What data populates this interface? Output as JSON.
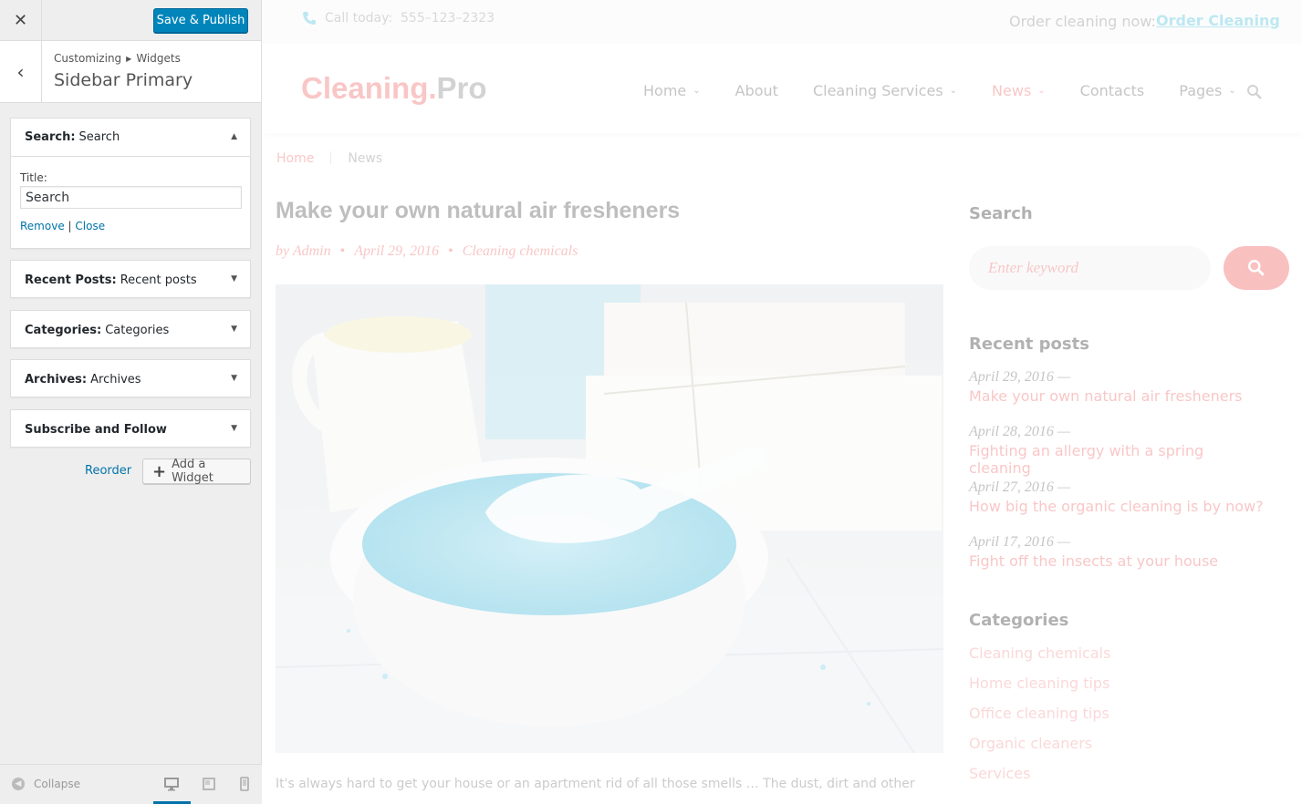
{
  "customizer": {
    "save_label": "Save & Publish",
    "breadcrumb_parent": "Customizing",
    "breadcrumb_child": "Widgets",
    "section_title": "Sidebar Primary",
    "widgets": {
      "search": {
        "type": "Search:",
        "name": "Search",
        "title_label": "Title:",
        "title_value": "Search",
        "remove": "Remove",
        "sep": "|",
        "close": "Close"
      },
      "recent": {
        "type": "Recent Posts:",
        "name": "Recent posts"
      },
      "categories": {
        "type": "Categories:",
        "name": "Categories"
      },
      "archives": {
        "type": "Archives:",
        "name": "Archives"
      },
      "subscribe": {
        "type": "Subscribe and Follow",
        "name": ""
      }
    },
    "reorder": "Reorder",
    "add_widget": "Add a Widget",
    "collapse": "Collapse"
  },
  "site": {
    "call_label": "Call today:",
    "phone": "555–123–2323",
    "order_label": "Order cleaning now:",
    "order_link": "Order Cleaning",
    "logo_a": "Cleaning.",
    "logo_b": "Pro",
    "nav": [
      {
        "label": "Home",
        "dropdown": true
      },
      {
        "label": "About",
        "dropdown": false
      },
      {
        "label": "Cleaning Services",
        "dropdown": true
      },
      {
        "label": "News",
        "dropdown": true,
        "active": true
      },
      {
        "label": "Contacts",
        "dropdown": false
      },
      {
        "label": "Pages",
        "dropdown": true
      }
    ],
    "crumb_home": "Home",
    "crumb_current": "News",
    "post_title": "Make your own natural air fresheners",
    "meta_author": "by Admin",
    "meta_date": "April 29, 2016",
    "meta_category": "Cleaning chemicals",
    "excerpt": "It's always hard to get your house or an apartment rid of all those smells … The dust, dirt and other",
    "sidebar": {
      "search_heading": "Search",
      "search_placeholder": "Enter keyword",
      "recent_heading": "Recent posts",
      "recent": [
        {
          "date": "April 29, 2016 —",
          "title": "Make your own natural air fresheners"
        },
        {
          "date": "April 28, 2016 —",
          "title": "Fighting an allergy with a spring cleaning"
        },
        {
          "date": "April 27, 2016 —",
          "title": "How big the organic cleaning is by now?"
        },
        {
          "date": "April 17, 2016 —",
          "title": "Fight off the insects at your house"
        }
      ],
      "categories_heading": "Categories",
      "categories": [
        "Cleaning chemicals",
        "Home cleaning tips",
        "Office cleaning tips",
        "Organic cleaners",
        "Services"
      ]
    }
  },
  "colors": {
    "accent": "#f06b6b",
    "wp_blue": "#0085ba",
    "link_teal": "#4fc3d9"
  }
}
